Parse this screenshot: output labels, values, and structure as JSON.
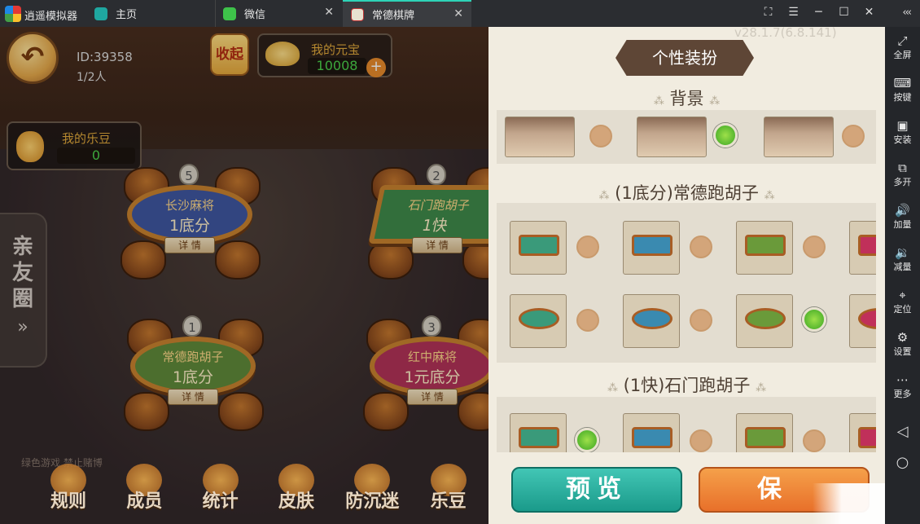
{
  "titlebar": {
    "app_title": "逍遥模拟器",
    "tabs": [
      {
        "label": "主页"
      },
      {
        "label": "微信",
        "close": "✕"
      },
      {
        "label": "常德棋牌",
        "close": "✕"
      }
    ],
    "controls": [
      "⛶",
      "☰",
      "─",
      "☐",
      "✕"
    ],
    "collapse": "‹‹‹"
  },
  "game": {
    "back_icon": "↶",
    "room_id": "ID:39358",
    "player_count": "1/2人",
    "fold_label": "收起",
    "coin": {
      "label": "我的元宝",
      "value": "10008",
      "plus": "+"
    },
    "bean": {
      "label": "我的乐豆",
      "value": "0"
    },
    "friends": {
      "chars": [
        "亲",
        "友",
        "圈"
      ],
      "arrow": "»"
    },
    "tables": [
      {
        "badge": "5",
        "name": "长沙麻将",
        "stake": "1底分",
        "detail": "详 情",
        "color": "#3f57a0",
        "shape": "round"
      },
      {
        "badge": "2",
        "name": "石门跑胡子",
        "stake": "1快",
        "detail": "详 情",
        "color": "#3f8a4a",
        "shape": "square"
      },
      {
        "badge": "1",
        "name": "常德跑胡子",
        "stake": "1底分",
        "detail": "详 情",
        "color": "#5f8a3a",
        "shape": "round"
      },
      {
        "badge": "3",
        "name": "红中麻将",
        "stake": "1元底分",
        "detail": "详 情",
        "color": "#b23258",
        "shape": "round"
      }
    ],
    "slogan": "绿色游戏 禁止赌博",
    "nav": [
      "规则",
      "成员",
      "统计",
      "皮肤",
      "防沉迷",
      "乐豆"
    ]
  },
  "panel": {
    "version": "v28.1.7(6.8.141)",
    "title": "个性装扮",
    "sections": {
      "background": "背景",
      "changde": "(1底分)常德跑胡子",
      "shimen": "(1快)石门跑胡子"
    },
    "decor": "⁂",
    "preview": "预览",
    "save": "保",
    "table_colors": [
      "#3a9a7a",
      "#3a8ab0",
      "#6a9a3a",
      "#c0305a"
    ]
  },
  "sidebar": {
    "items": [
      {
        "icon": "⤢",
        "label": "全屏"
      },
      {
        "icon": "⌨",
        "label": "按键"
      },
      {
        "icon": "▣",
        "label": "安装"
      },
      {
        "icon": "⧉",
        "label": "多开"
      },
      {
        "icon": "🔊",
        "label": "加量"
      },
      {
        "icon": "🔉",
        "label": "减量"
      },
      {
        "icon": "⌖",
        "label": "定位"
      },
      {
        "icon": "⚙",
        "label": "设置"
      },
      {
        "icon": "⋯",
        "label": "更多"
      }
    ],
    "nav_back": "◁",
    "nav_home": "○"
  }
}
